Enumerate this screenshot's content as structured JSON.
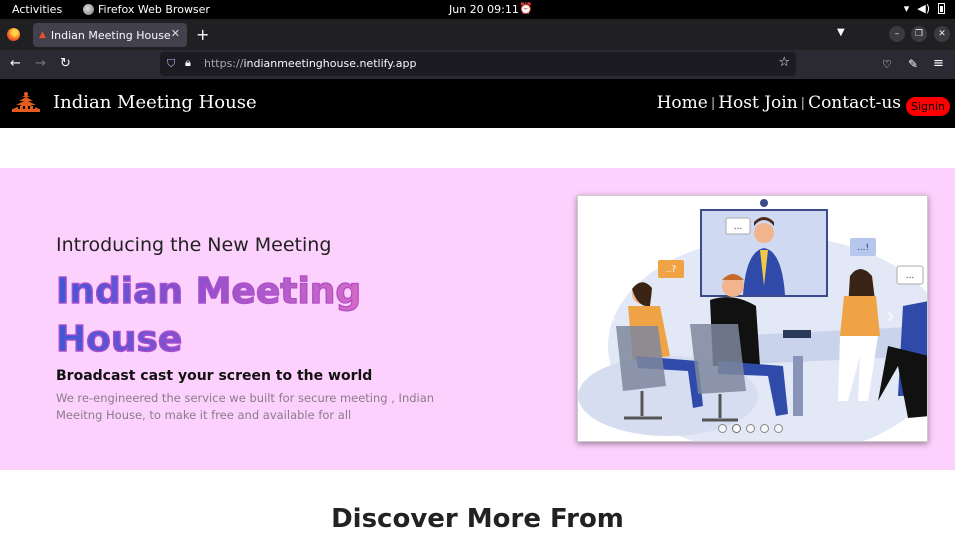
{
  "system_bar": {
    "activities": "Activities",
    "app_name": "Firefox Web Browser",
    "clock": "Jun 20  09:11"
  },
  "browser": {
    "tab_title": "Indian Meeting House",
    "url_protocol": "https://",
    "url_host": "indianmeetinghouse.netlify.app"
  },
  "site": {
    "brand": "Indian Meeting House",
    "nav": [
      "Home",
      "Host Join",
      "Contact-us"
    ],
    "nav_separator": "|",
    "signin_label": "Signin"
  },
  "hero": {
    "intro": "Introducing the New Meeting",
    "headline_line1": "Indian Meeting",
    "headline_line2": "House",
    "tagline": "Broadcast cast your screen to the world",
    "description": "We re-engineered the service we built for secure meeting , Indian Meeitng House, to make it free and available for all",
    "carousel": {
      "slide_count": 5,
      "active_index": 1,
      "bubbles": [
        "...",
        "..?",
        "...!",
        "..."
      ]
    }
  },
  "section": {
    "title": "Discover More From"
  },
  "colors": {
    "hero_bg": "#fdd1fd",
    "header_bg": "#000000",
    "signin_bg": "#ff0000",
    "headline_gradient_start": "#3d57d8",
    "headline_gradient_end": "#d66bc5"
  }
}
